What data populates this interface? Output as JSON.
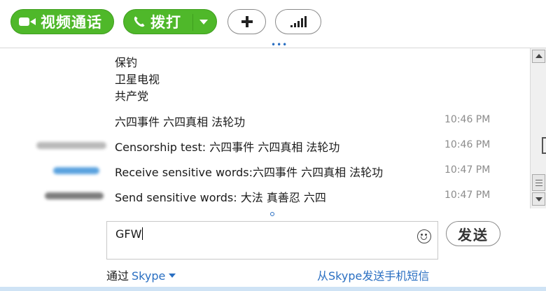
{
  "toolbar": {
    "video_call_label": "视频通话",
    "call_label": "拨打",
    "add_icon": "plus-icon",
    "signal_icon": "signal-bars-icon",
    "accent_color": "#4fb82a"
  },
  "chat": {
    "messages": [
      {
        "text": "保钓",
        "time": ""
      },
      {
        "text": "卫星电视",
        "time": ""
      },
      {
        "text": "共产党",
        "time": ""
      },
      {
        "text": "六四事件 六四真相 法轮功",
        "time": "10:46 PM"
      },
      {
        "text": "Censorship test: 六四事件 六四真相 法轮功",
        "time": "10:46 PM"
      },
      {
        "text": "Receive sensitive words:六四事件 六四真相 法轮功",
        "time": "10:47 PM"
      },
      {
        "text": "Send sensitive words: 大法 真善忍 六四",
        "time": "10:47 PM"
      }
    ]
  },
  "composer": {
    "input_value": "GFW",
    "send_label": "发送",
    "via_label": "通过",
    "via_service": "Skype",
    "sms_link": "从Skype发送手机短信",
    "link_color": "#2a6fc2"
  }
}
